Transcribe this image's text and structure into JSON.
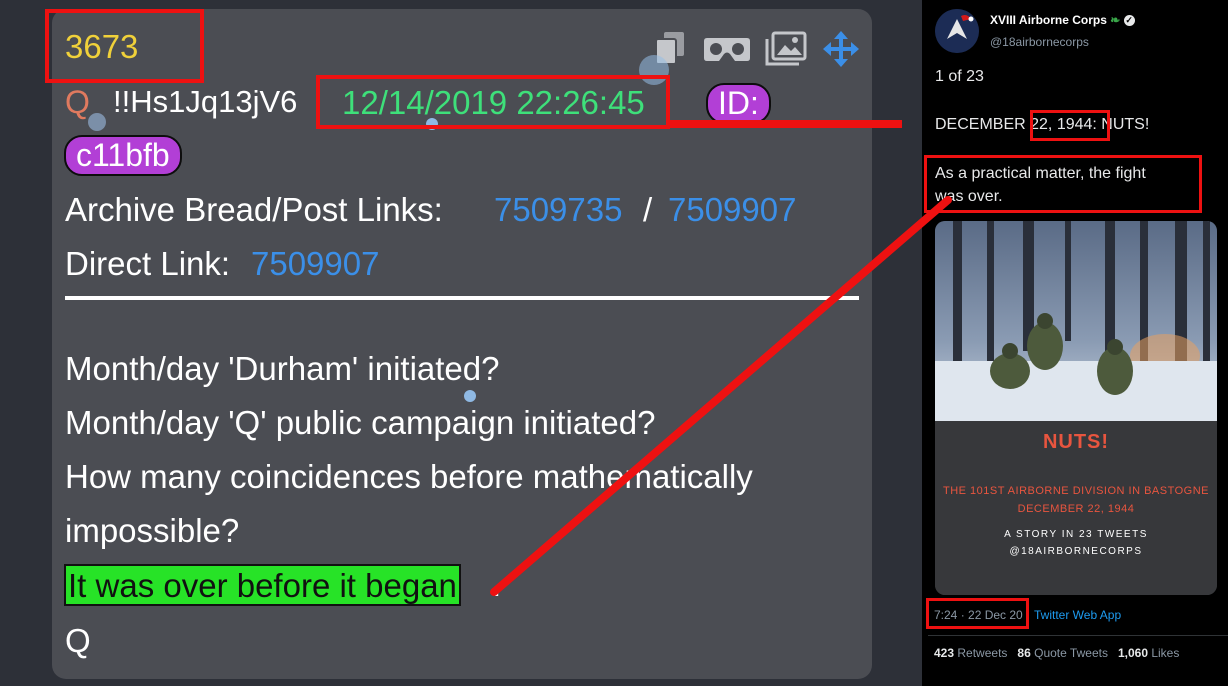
{
  "post": {
    "number": "3673",
    "q_letter": "Q",
    "tripcode": "!!Hs1Jq13jV6",
    "date": "12/14/2019 22:26:45",
    "id_label": "ID:",
    "id_value": "c11bfb",
    "archive_label": "Archive Bread/Post Links:",
    "archive_link_1": "7509735",
    "archive_sep": "/",
    "archive_link_2": "7509907",
    "direct_label": "Direct Link:",
    "direct_link": "7509907",
    "lines": [
      "Month/day 'Durham' initiated?",
      "Month/day 'Q' public campaign initiated?",
      "How many coincidences before mathematically",
      "impossible?",
      "It was over before it began",
      "."
    ],
    "signature": "Q",
    "colors": {
      "number": "#f0d13a",
      "date": "#3ee07a",
      "id_pill": "#b23fd6",
      "link": "#3b8fe8",
      "highlight": "#27e327",
      "annotation": "#ee1111"
    },
    "icons": [
      "copy-icon",
      "vr-headset-icon",
      "gallery-icon",
      "move-arrows-icon"
    ]
  },
  "tweet": {
    "account_name": "XVIII Airborne Corps",
    "handle": "@18airbornecorps",
    "counter": "1 of 23",
    "line_1_pre": "DECEMBER ",
    "line_1_mid": "22, 1944",
    "line_1_post": ": NUTS!",
    "line_2a": "As a practical matter, the fight",
    "line_2b": "was over.",
    "image": {
      "title": "NUTS!",
      "sub_1": "THE 101ST AIRBORNE DIVISION IN BASTOGNE",
      "sub_2": "DECEMBER 22, 1944",
      "sub_3": "A STORY IN 23 TWEETS",
      "sub_4": "@18AIRBORNECORPS"
    },
    "timestamp": "7:24 · 22 Dec 20",
    "source": "Twitter Web App",
    "retweets": "423",
    "retweets_label": "Retweets",
    "quotes": "86",
    "quotes_label": "Quote Tweets",
    "likes": "1,060",
    "likes_label": "Likes"
  }
}
